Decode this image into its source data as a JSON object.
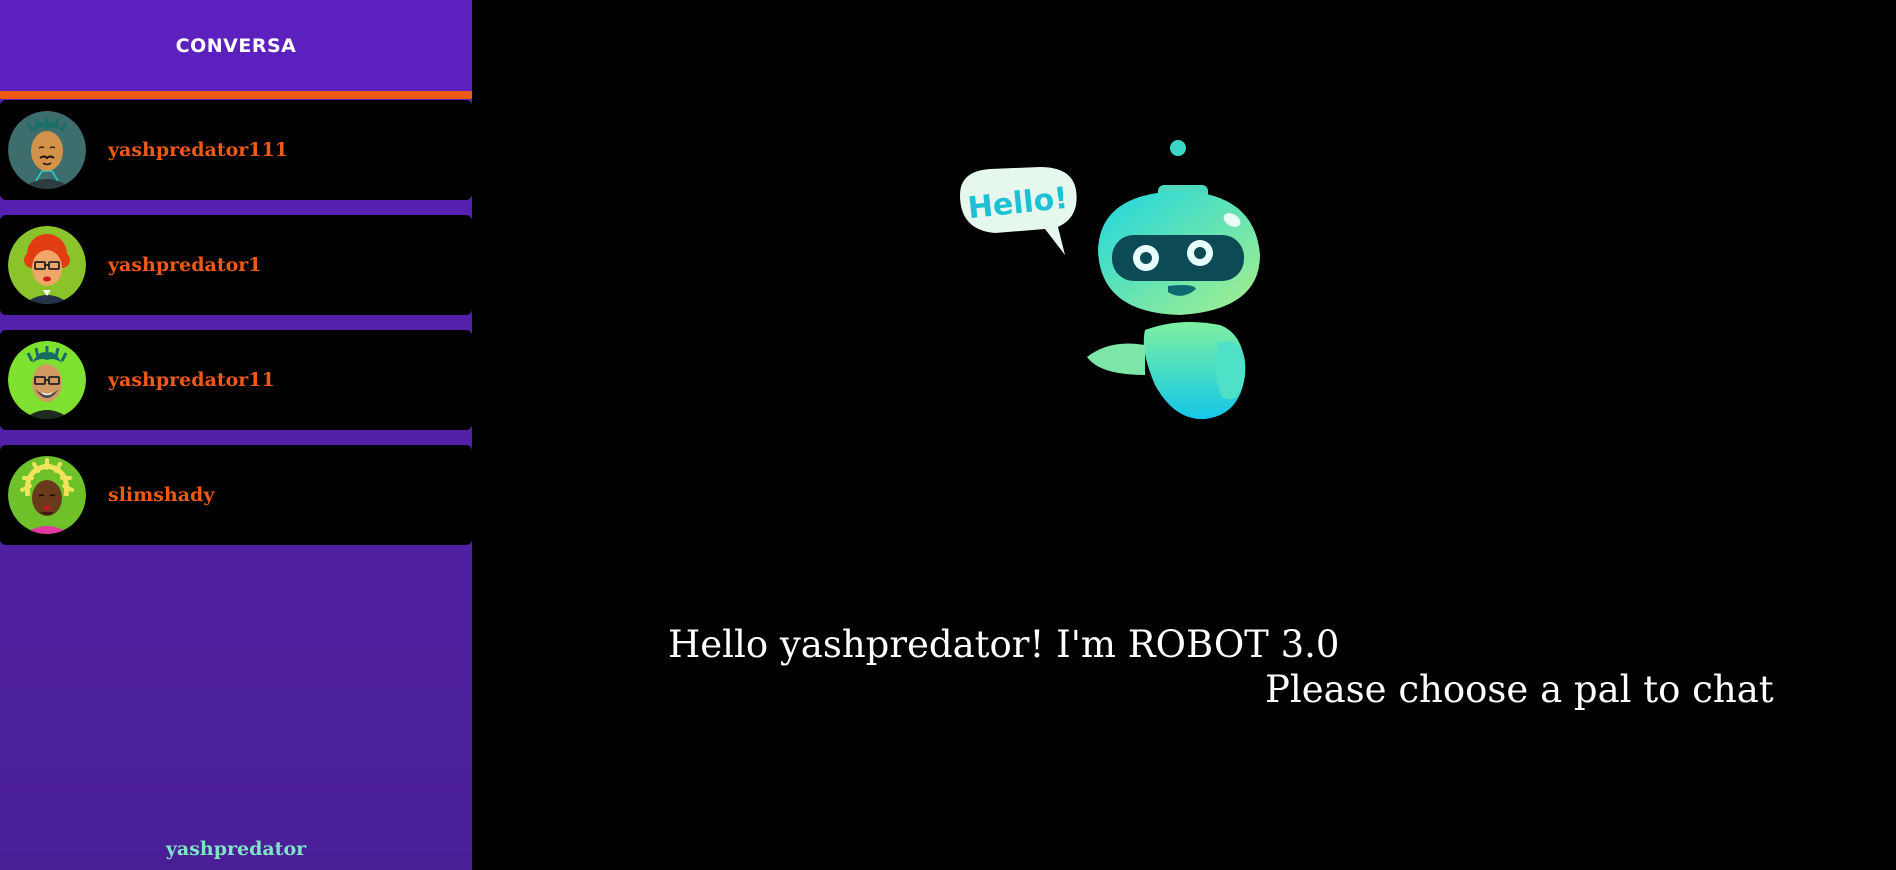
{
  "app": {
    "title": "CONVERSA",
    "accent": "#ec5a16",
    "sidebar_color": "#5b20bd"
  },
  "contacts": [
    {
      "name": "yashpredator111",
      "avatar": "avatar-teal-mustache"
    },
    {
      "name": "yashpredator1",
      "avatar": "avatar-red-hair-glasses"
    },
    {
      "name": "yashpredator11",
      "avatar": "avatar-green-glasses-beard"
    },
    {
      "name": "slimshady",
      "avatar": "avatar-yellow-dreadlocks"
    }
  ],
  "current_user": "yashpredator",
  "welcome": {
    "greeting_prefix": "Hello ",
    "username": "yashpredator",
    "greeting_suffix": "! I'm ROBOT 3.0",
    "subtitle": "Please choose a pal to chat",
    "bubble_text": "Hello!"
  }
}
